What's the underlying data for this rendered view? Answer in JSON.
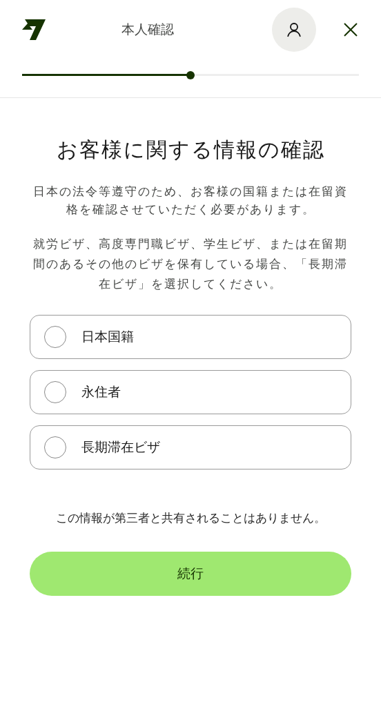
{
  "header": {
    "title": "本人確認",
    "progress": {
      "level": 0.5
    }
  },
  "heading": "お客様に関する情報の確認",
  "paragraphs": [
    "日本の法令等遵守のため、お客様の国籍または在留資格を確認させていただく必要があります。",
    "就労ビザ、高度専門職ビザ、学生ビザ、または在留期間のあるその他のビザを保有している場合、「長期滞在ビザ」を選択してください。"
  ],
  "options": [
    {
      "label": "日本国籍",
      "selected": false
    },
    {
      "label": "永住者",
      "selected": false
    },
    {
      "label": "長期滞在ビザ",
      "selected": false
    }
  ],
  "note": "この情報が第三者と共有されることはありません。",
  "continue_button": "続行"
}
